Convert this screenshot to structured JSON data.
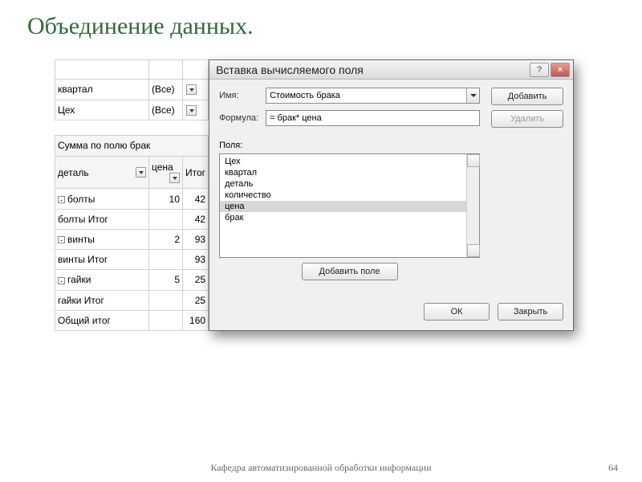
{
  "slide": {
    "title": "Объединение данных.",
    "footer": "Кафедра автоматизированной обработки информации",
    "page": "64"
  },
  "pivot": {
    "filters": [
      {
        "label": "квартал",
        "value": "(Все)"
      },
      {
        "label": "Цех",
        "value": "(Все)"
      }
    ],
    "sum_label": "Сумма по полю брак",
    "col_headers": {
      "detail": "деталь",
      "price": "цена",
      "total": "Итог"
    },
    "rows": [
      {
        "label": "болты",
        "price": "10",
        "total": "42",
        "expand": true
      },
      {
        "label": "болты Итог",
        "price": "",
        "total": "42",
        "expand": false,
        "subtotal": true
      },
      {
        "label": "винты",
        "price": "2",
        "total": "93",
        "expand": true
      },
      {
        "label": "винты Итог",
        "price": "",
        "total": "93",
        "expand": false,
        "subtotal": true
      },
      {
        "label": "гайки",
        "price": "5",
        "total": "25",
        "expand": true
      },
      {
        "label": "гайки Итог",
        "price": "",
        "total": "25",
        "expand": false,
        "subtotal": true
      }
    ],
    "grand": {
      "label": "Общий итог",
      "value": "160"
    }
  },
  "dialog": {
    "title": "Вставка вычисляемого поля",
    "name_label": "Имя:",
    "name_value": "Стоимость брака",
    "formula_label": "Формула:",
    "formula_value": "= брак* цена",
    "add_btn": "Добавить",
    "delete_btn": "Удалить",
    "fields_label": "Поля:",
    "fields": [
      "Цех",
      "квартал",
      "деталь",
      "количество",
      "цена",
      "брак"
    ],
    "selected_field_index": 4,
    "add_field_btn": "Добавить поле",
    "ok_btn": "ОК",
    "close_btn": "Закрыть"
  }
}
